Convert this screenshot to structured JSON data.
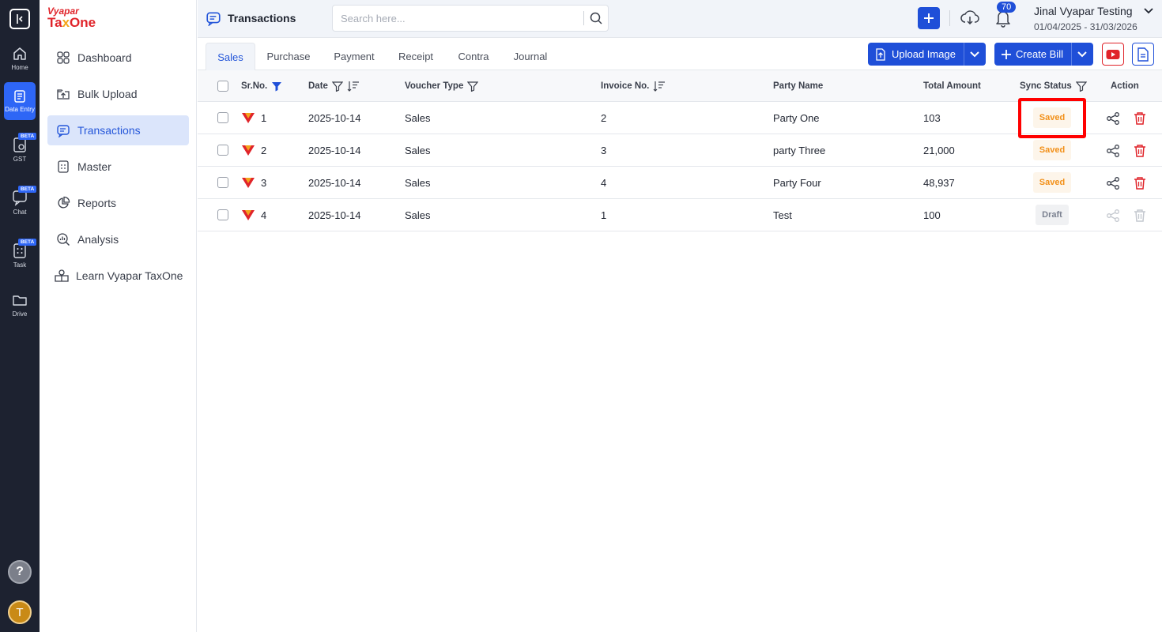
{
  "rail": {
    "items": [
      {
        "label": "Home",
        "icon": "home-icon"
      },
      {
        "label": "Data Entry",
        "icon": "data-entry-icon",
        "active": true
      },
      {
        "label": "GST",
        "icon": "gst-icon",
        "badge": "BETA"
      },
      {
        "label": "Chat",
        "icon": "chat-icon",
        "badge": "BETA"
      },
      {
        "label": "Task",
        "icon": "task-icon",
        "badge": "BETA"
      },
      {
        "label": "Drive",
        "icon": "folder-icon"
      }
    ],
    "help": "?",
    "avatar": "T"
  },
  "brand": {
    "top": "Vyapar",
    "bottom_a": "Ta",
    "bottom_x": "x",
    "bottom_b": "One"
  },
  "sidenav": {
    "items": [
      {
        "label": "Dashboard",
        "icon": "dashboard-icon"
      },
      {
        "label": "Bulk Upload",
        "icon": "upload-icon"
      },
      {
        "label": "Transactions",
        "icon": "transactions-icon",
        "active": true
      },
      {
        "label": "Master",
        "icon": "master-icon"
      },
      {
        "label": "Reports",
        "icon": "pie-chart-icon"
      },
      {
        "label": "Analysis",
        "icon": "analysis-icon"
      },
      {
        "label": "Learn Vyapar TaxOne",
        "icon": "learn-icon"
      }
    ]
  },
  "header": {
    "title": "Transactions",
    "search_placeholder": "Search here...",
    "notifications": "70",
    "user_name": "Jinal Vyapar Testing",
    "period": "01/04/2025 - 31/03/2026"
  },
  "tabs": [
    "Sales",
    "Purchase",
    "Payment",
    "Receipt",
    "Contra",
    "Journal"
  ],
  "actions": {
    "upload_image": "Upload Image",
    "create_bill": "Create Bill"
  },
  "table": {
    "headers": {
      "sr": "Sr.No.",
      "date": "Date",
      "voucher": "Voucher Type",
      "invoice": "Invoice No.",
      "party": "Party Name",
      "amount": "Total Amount",
      "sync": "Sync Status",
      "action": "Action"
    },
    "rows": [
      {
        "sr": "1",
        "date": "2025-10-14",
        "voucher": "Sales",
        "invoice": "2",
        "party": "Party One",
        "amount": "103",
        "status": "Saved"
      },
      {
        "sr": "2",
        "date": "2025-10-14",
        "voucher": "Sales",
        "invoice": "3",
        "party": "party Three",
        "amount": "21,000",
        "status": "Saved"
      },
      {
        "sr": "3",
        "date": "2025-10-14",
        "voucher": "Sales",
        "invoice": "4",
        "party": "Party Four",
        "amount": "48,937",
        "status": "Saved"
      },
      {
        "sr": "4",
        "date": "2025-10-14",
        "voucher": "Sales",
        "invoice": "1",
        "party": "Test",
        "amount": "100",
        "status": "Draft"
      }
    ]
  },
  "colors": {
    "primary": "#1f4fd8",
    "brand_red": "#e0242a",
    "saved": "#f29019",
    "draft": "#7b8190"
  }
}
